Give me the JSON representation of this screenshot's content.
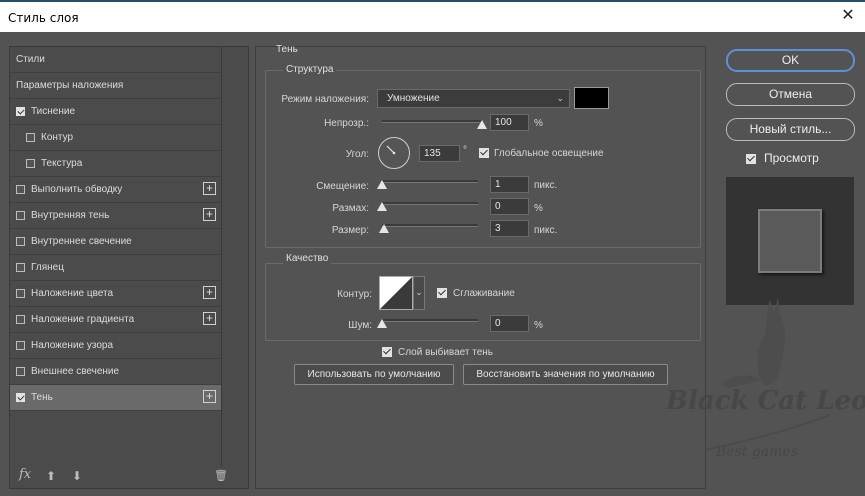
{
  "window": {
    "title": "Стиль слоя",
    "close_label": "✕"
  },
  "styles_list": [
    {
      "label": "Стили",
      "checkbox": false,
      "checked": false,
      "indent": 0,
      "plus": false
    },
    {
      "label": "Параметры наложения",
      "checkbox": false,
      "checked": false,
      "indent": 0,
      "plus": false
    },
    {
      "label": "Тиснение",
      "checkbox": true,
      "checked": true,
      "indent": 0,
      "plus": false
    },
    {
      "label": "Контур",
      "checkbox": true,
      "checked": false,
      "indent": 1,
      "plus": false
    },
    {
      "label": "Текстура",
      "checkbox": true,
      "checked": false,
      "indent": 1,
      "plus": false
    },
    {
      "label": "Выполнить обводку",
      "checkbox": true,
      "checked": false,
      "indent": 0,
      "plus": true
    },
    {
      "label": "Внутренняя тень",
      "checkbox": true,
      "checked": false,
      "indent": 0,
      "plus": true
    },
    {
      "label": "Внутреннее свечение",
      "checkbox": true,
      "checked": false,
      "indent": 0,
      "plus": false
    },
    {
      "label": "Глянец",
      "checkbox": true,
      "checked": false,
      "indent": 0,
      "plus": false
    },
    {
      "label": "Наложение цвета",
      "checkbox": true,
      "checked": false,
      "indent": 0,
      "plus": true
    },
    {
      "label": "Наложение градиента",
      "checkbox": true,
      "checked": false,
      "indent": 0,
      "plus": true
    },
    {
      "label": "Наложение узора",
      "checkbox": true,
      "checked": false,
      "indent": 0,
      "plus": false
    },
    {
      "label": "Внешнее свечение",
      "checkbox": true,
      "checked": false,
      "indent": 0,
      "plus": false
    },
    {
      "label": "Тень",
      "checkbox": true,
      "checked": true,
      "indent": 0,
      "plus": true,
      "selected": true
    }
  ],
  "left_footer": {
    "fx_label": "fx",
    "up_glyph": "⬆",
    "down_glyph": "⬇",
    "trash_glyph": "🗑"
  },
  "shadow": {
    "section_title": "Тень",
    "structure": {
      "title": "Структура",
      "blend_mode_label": "Режим наложения:",
      "blend_mode_value": "Умножение",
      "shadow_color": "#000000",
      "opacity_label": "Непрозр.:",
      "opacity_value": "100",
      "opacity_unit": "%",
      "opacity_fraction": 1.0,
      "angle_label": "Угол:",
      "angle_value": "135",
      "angle_unit": "°",
      "global_light_label": "Глобальное освещение",
      "global_light_checked": true,
      "distance_label": "Смещение:",
      "distance_value": "1",
      "distance_unit": "пикс.",
      "distance_fraction": 0.0,
      "spread_label": "Размах:",
      "spread_value": "0",
      "spread_unit": "%",
      "spread_fraction": 0.0,
      "size_label": "Размер:",
      "size_value": "3",
      "size_unit": "пикс.",
      "size_fraction": 0.02
    },
    "quality": {
      "title": "Качество",
      "contour_label": "Контур:",
      "antialias_label": "Сглаживание",
      "antialias_checked": true,
      "noise_label": "Шум:",
      "noise_value": "0",
      "noise_unit": "%",
      "noise_fraction": 0.0
    },
    "knockout_label": "Слой выбивает тень",
    "knockout_checked": true,
    "make_default_label": "Использовать по умолчанию",
    "reset_default_label": "Восстановить значения по умолчанию"
  },
  "right": {
    "ok_label": "OK",
    "cancel_label": "Отмена",
    "new_style_label": "Новый стиль...",
    "preview_label": "Просмотр",
    "preview_checked": true
  },
  "watermark": {
    "line1": "Black Cat Leo",
    "line2": "Best games"
  },
  "colors": {
    "accent": "#5e8fd8",
    "panel": "#535353",
    "selected_row": "#6a6a6a"
  }
}
